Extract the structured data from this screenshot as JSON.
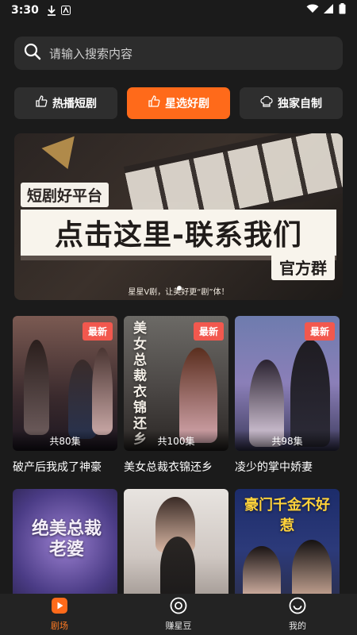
{
  "status_bar": {
    "time": "3:30"
  },
  "search": {
    "placeholder": "请输入搜索内容"
  },
  "tabs": [
    {
      "label": "热播短剧",
      "icon": "thumb-icon"
    },
    {
      "label": "星选好剧",
      "icon": "thumb-up-icon",
      "active": true
    },
    {
      "label": "独家自制",
      "icon": "chef-hat-icon"
    }
  ],
  "banner": {
    "tag": "短剧好平台",
    "headline": "点击这里-联系我们",
    "group": "官方群",
    "slogan": "星星V剧，让美好更“剧”体！"
  },
  "dramas": [
    {
      "title": "破产后我成了神豪",
      "badge": "最新",
      "episodes": "共80集"
    },
    {
      "title": "美女总裁衣锦还乡",
      "badge": "最新",
      "episodes": "共100集"
    },
    {
      "title": "凌少的掌中娇妻",
      "badge": "最新",
      "episodes": "共98集"
    },
    {
      "title": "",
      "badge": "",
      "episodes": ""
    },
    {
      "title": "",
      "badge": "",
      "episodes": ""
    },
    {
      "title": "",
      "badge": "",
      "episodes": ""
    }
  ],
  "poster_text": {
    "p2": "美女总裁衣锦还乡",
    "p4": "绝美总裁老婆",
    "p6": "豪门千金不好惹"
  },
  "bottom_nav": [
    {
      "label": "剧场",
      "icon": "play-icon",
      "active": true
    },
    {
      "label": "赚星豆",
      "icon": "coin-icon"
    },
    {
      "label": "我的",
      "icon": "profile-icon"
    }
  ],
  "colors": {
    "accent": "#ff6a1a",
    "badge": "#f2584e",
    "bg": "#1b1b1b"
  }
}
